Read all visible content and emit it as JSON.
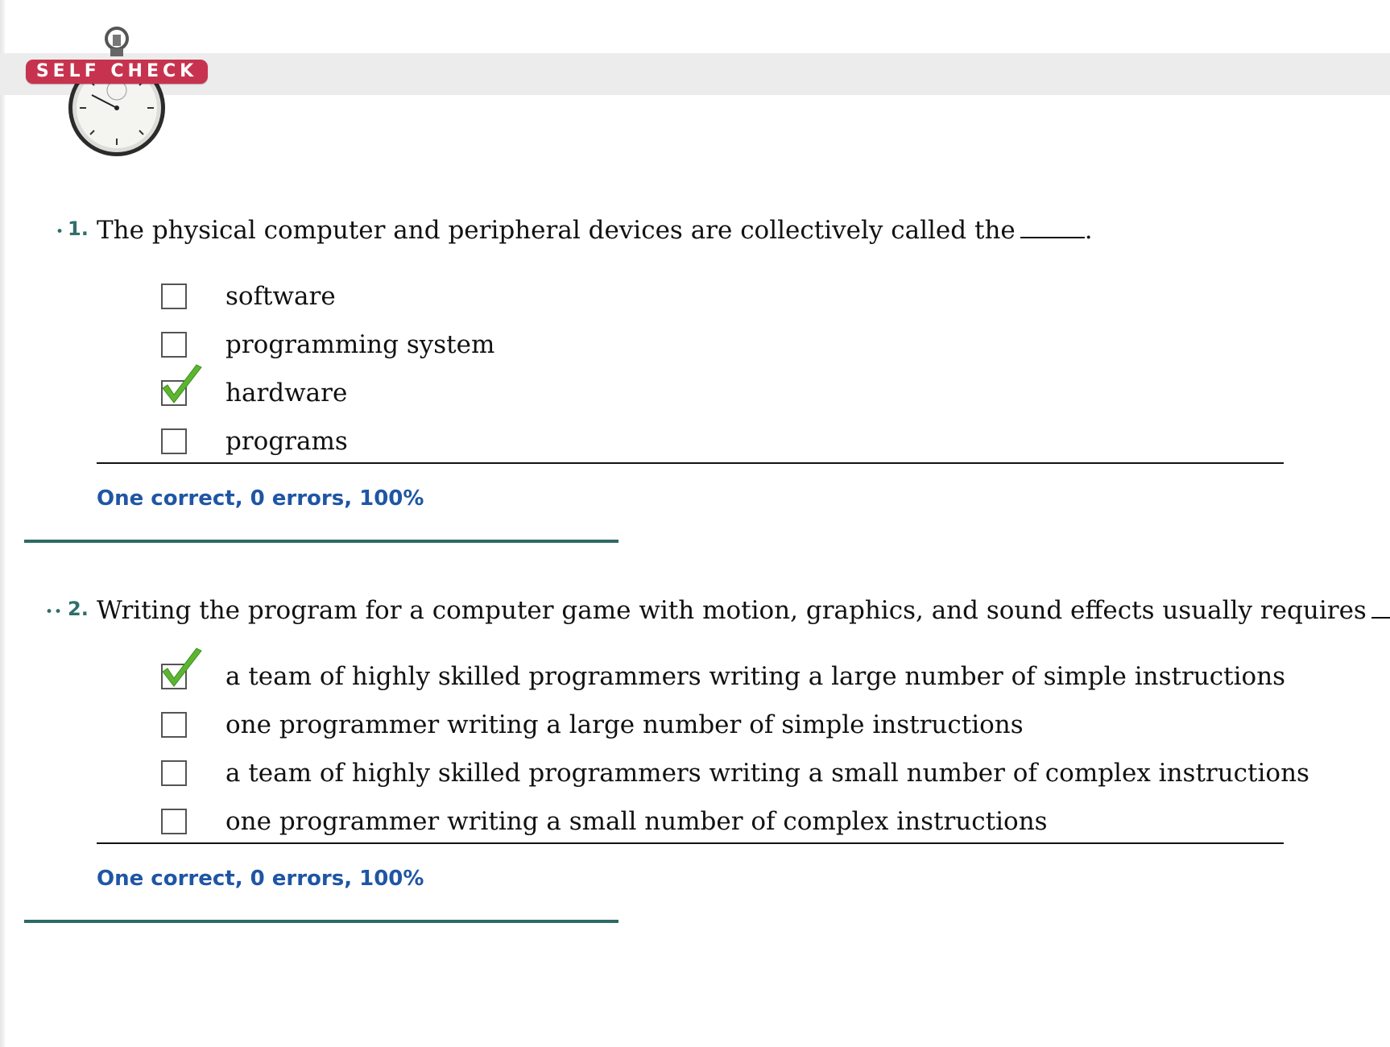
{
  "header": {
    "badge_label": "SELF CHECK"
  },
  "questions": [
    {
      "bullets": "•",
      "number": "1.",
      "stem": "The physical computer and peripheral devices are collectively called the",
      "stem_end": ".",
      "options": [
        {
          "label": "software",
          "checked": false
        },
        {
          "label": "programming system",
          "checked": false
        },
        {
          "label": "hardware",
          "checked": true
        },
        {
          "label": "programs",
          "checked": false
        }
      ],
      "score": "One correct, 0 errors, 100%"
    },
    {
      "bullets": "••",
      "number": "2.",
      "stem": "Writing the program for a computer game with motion, graphics, and sound effects usually requires",
      "stem_end": ".",
      "options": [
        {
          "label": "a team of highly skilled programmers writing a large number of simple instructions",
          "checked": true
        },
        {
          "label": "one programmer writing a large number of simple instructions",
          "checked": false
        },
        {
          "label": "a team of highly skilled programmers writing a small number of complex instructions",
          "checked": false
        },
        {
          "label": "one programmer writing a small number of complex instructions",
          "checked": false
        }
      ],
      "score": "One correct, 0 errors, 100%"
    }
  ],
  "colors": {
    "badge": "#c7334e",
    "accent_teal": "#2d6a64",
    "score_blue": "#1f56a4",
    "check_green": "#5cb531"
  }
}
